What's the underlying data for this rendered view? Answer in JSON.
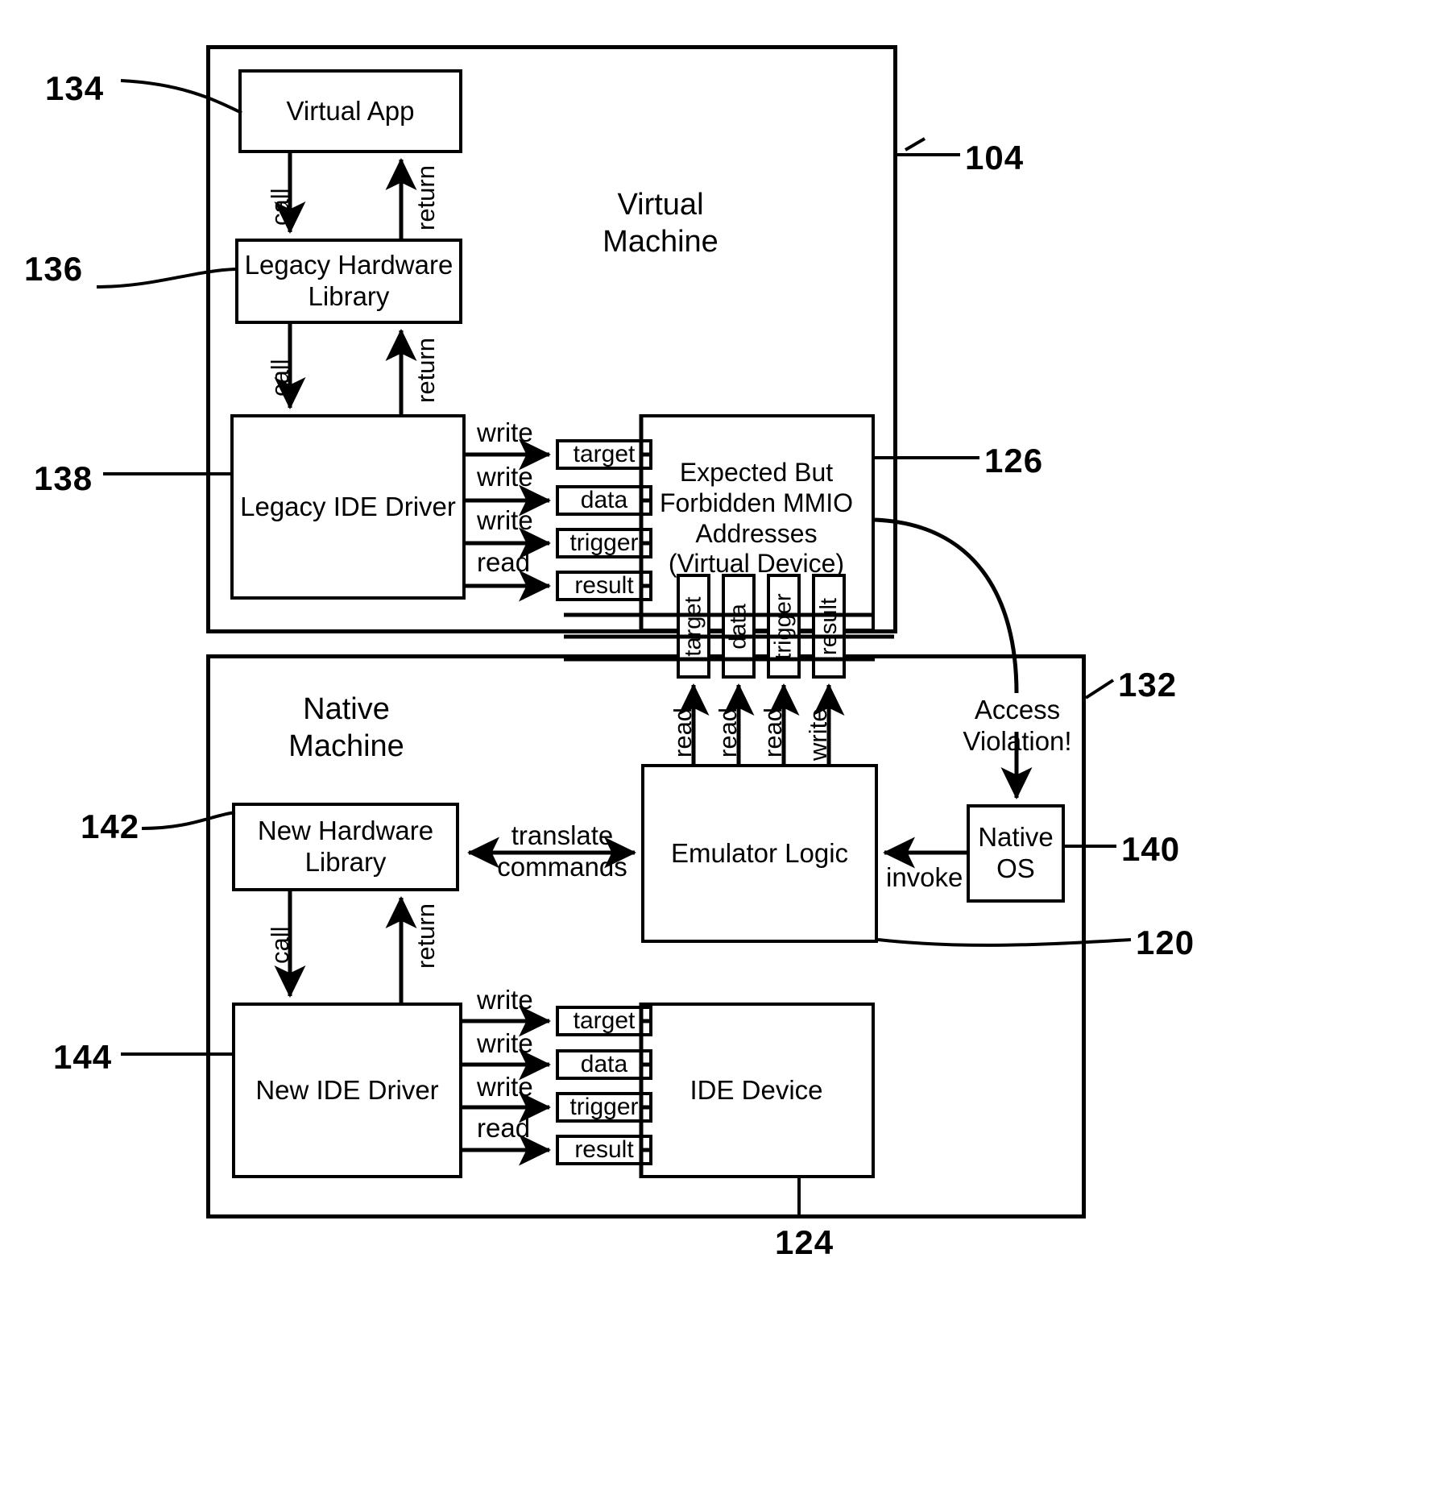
{
  "figure": {
    "containers": [
      {
        "name": "virtual-machine",
        "title": "Virtual\nMachine",
        "ref": "104"
      },
      {
        "name": "native-machine",
        "title": "Native\nMachine",
        "ref": "132"
      }
    ],
    "blocks": {
      "virtual_app": "Virtual App",
      "legacy_hardware_library": "Legacy Hardware\nLibrary",
      "legacy_ide_driver": "Legacy IDE Driver",
      "virtual_device": "Expected But\nForbidden MMIO\nAddresses\n(Virtual Device)",
      "new_hardware_library": "New Hardware\nLibrary",
      "new_ide_driver": "New IDE Driver",
      "emulator_logic": "Emulator Logic",
      "native_os": "Native\nOS",
      "ide_device": "IDE Device"
    },
    "registers": {
      "virtual_horizontal": [
        "target",
        "data",
        "trigger",
        "result"
      ],
      "shared_vertical": [
        "target",
        "data",
        "trigger",
        "result"
      ],
      "native_horizontal": [
        "target",
        "data",
        "trigger",
        "result"
      ]
    },
    "edge_labels": {
      "vm_app_call": "call",
      "vm_app_return": "return",
      "vm_lib_call": "call",
      "vm_lib_return": "return",
      "vm_driver_ops": [
        "write",
        "write",
        "write",
        "read"
      ],
      "emulator_ops": [
        "read",
        "read",
        "read",
        "write"
      ],
      "translate_commands": "translate\ncommands",
      "invoke": "invoke",
      "access_violation": "Access\nViolation!",
      "nm_lib_call": "call",
      "nm_lib_return": "return",
      "nm_driver_ops": [
        "write",
        "write",
        "write",
        "read"
      ]
    },
    "reference_numbers": {
      "n134": "134",
      "n136": "136",
      "n138": "138",
      "n104": "104",
      "n126": "126",
      "n132": "132",
      "n140": "140",
      "n142": "142",
      "n144": "144",
      "n120": "120",
      "n124": "124"
    },
    "colors": {
      "ink": "#000000",
      "paper": "#ffffff"
    }
  }
}
